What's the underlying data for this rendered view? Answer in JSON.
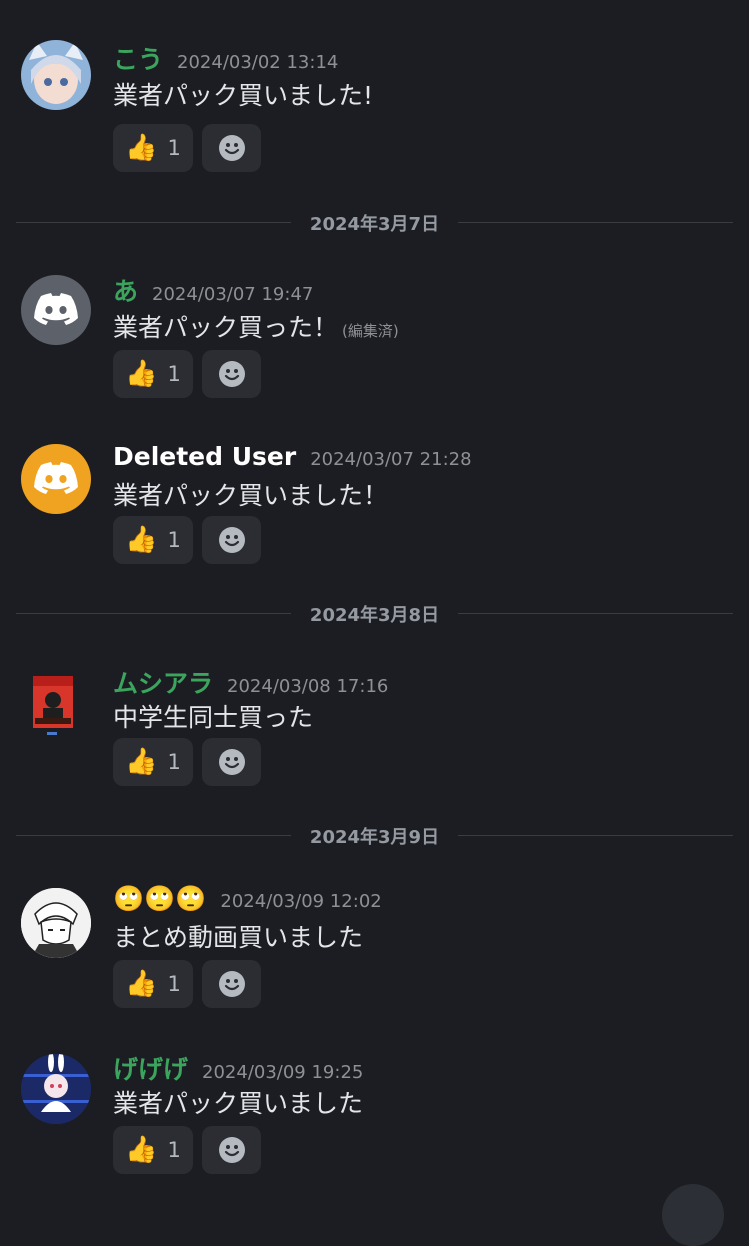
{
  "messages": [
    {
      "username": "こう",
      "name_color": "#3ba55d",
      "timestamp": "2024/03/02 13:14",
      "text": "業者パック買いました!",
      "edited": "",
      "reaction_count": "1",
      "avatar": "anime-avatar"
    },
    {
      "username": "あ",
      "name_color": "#3ba55d",
      "timestamp": "2024/03/07 19:47",
      "text": "業者パック買った！",
      "edited": "(編集済)",
      "reaction_count": "1",
      "avatar": "discord-default-avatar"
    },
    {
      "username": "Deleted User",
      "name_color": "#ffffff",
      "timestamp": "2024/03/07 21:28",
      "text": "業者パック買いました！",
      "edited": "",
      "reaction_count": "1",
      "avatar": "discord-default-avatar"
    },
    {
      "username": "ムシアラ",
      "name_color": "#3ba55d",
      "timestamp": "2024/03/08 17:16",
      "text": "中学生同士買った",
      "edited": "",
      "reaction_count": "1",
      "avatar": "card-avatar"
    },
    {
      "username": "🙄🙄🙄",
      "name_color": "#3ba55d",
      "timestamp": "2024/03/09 12:02",
      "text": "まとめ動画買いました",
      "edited": "",
      "reaction_count": "1",
      "avatar": "manga-avatar"
    },
    {
      "username": "げげげ",
      "name_color": "#3ba55d",
      "timestamp": "2024/03/09 19:25",
      "text": "業者パック買いました",
      "edited": "",
      "reaction_count": "1",
      "avatar": "anime-avatar"
    }
  ],
  "dividers": [
    "2024年3月7日",
    "2024年3月8日",
    "2024年3月9日"
  ],
  "icons": {
    "reaction": "thumbs-up-icon",
    "add_reaction": "smiley-icon"
  },
  "colors": {
    "background": "#1c1d22",
    "green_name": "#3ba55d",
    "discord_gray": "#5d6169",
    "discord_orange": "#f0a320"
  }
}
